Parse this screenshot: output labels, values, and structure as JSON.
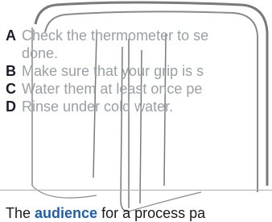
{
  "options": [
    {
      "letter": "A",
      "line1": "Check the thermometer to se",
      "line2": "done."
    },
    {
      "letter": "B",
      "line1": "Make sure that your grip is s"
    },
    {
      "letter": "C",
      "line1": "Water them at least once pe"
    },
    {
      "letter": "D",
      "line1": "Rinse under cold water."
    }
  ],
  "sentence": {
    "before": "The ",
    "keyword": "audience",
    "after": " for a process pa"
  },
  "colors": {
    "accent": "#1f5fa8",
    "option_text": "#9aa0a4",
    "divider": "#8fb8c9"
  },
  "icons": {
    "illustration": "open-book-icon"
  }
}
